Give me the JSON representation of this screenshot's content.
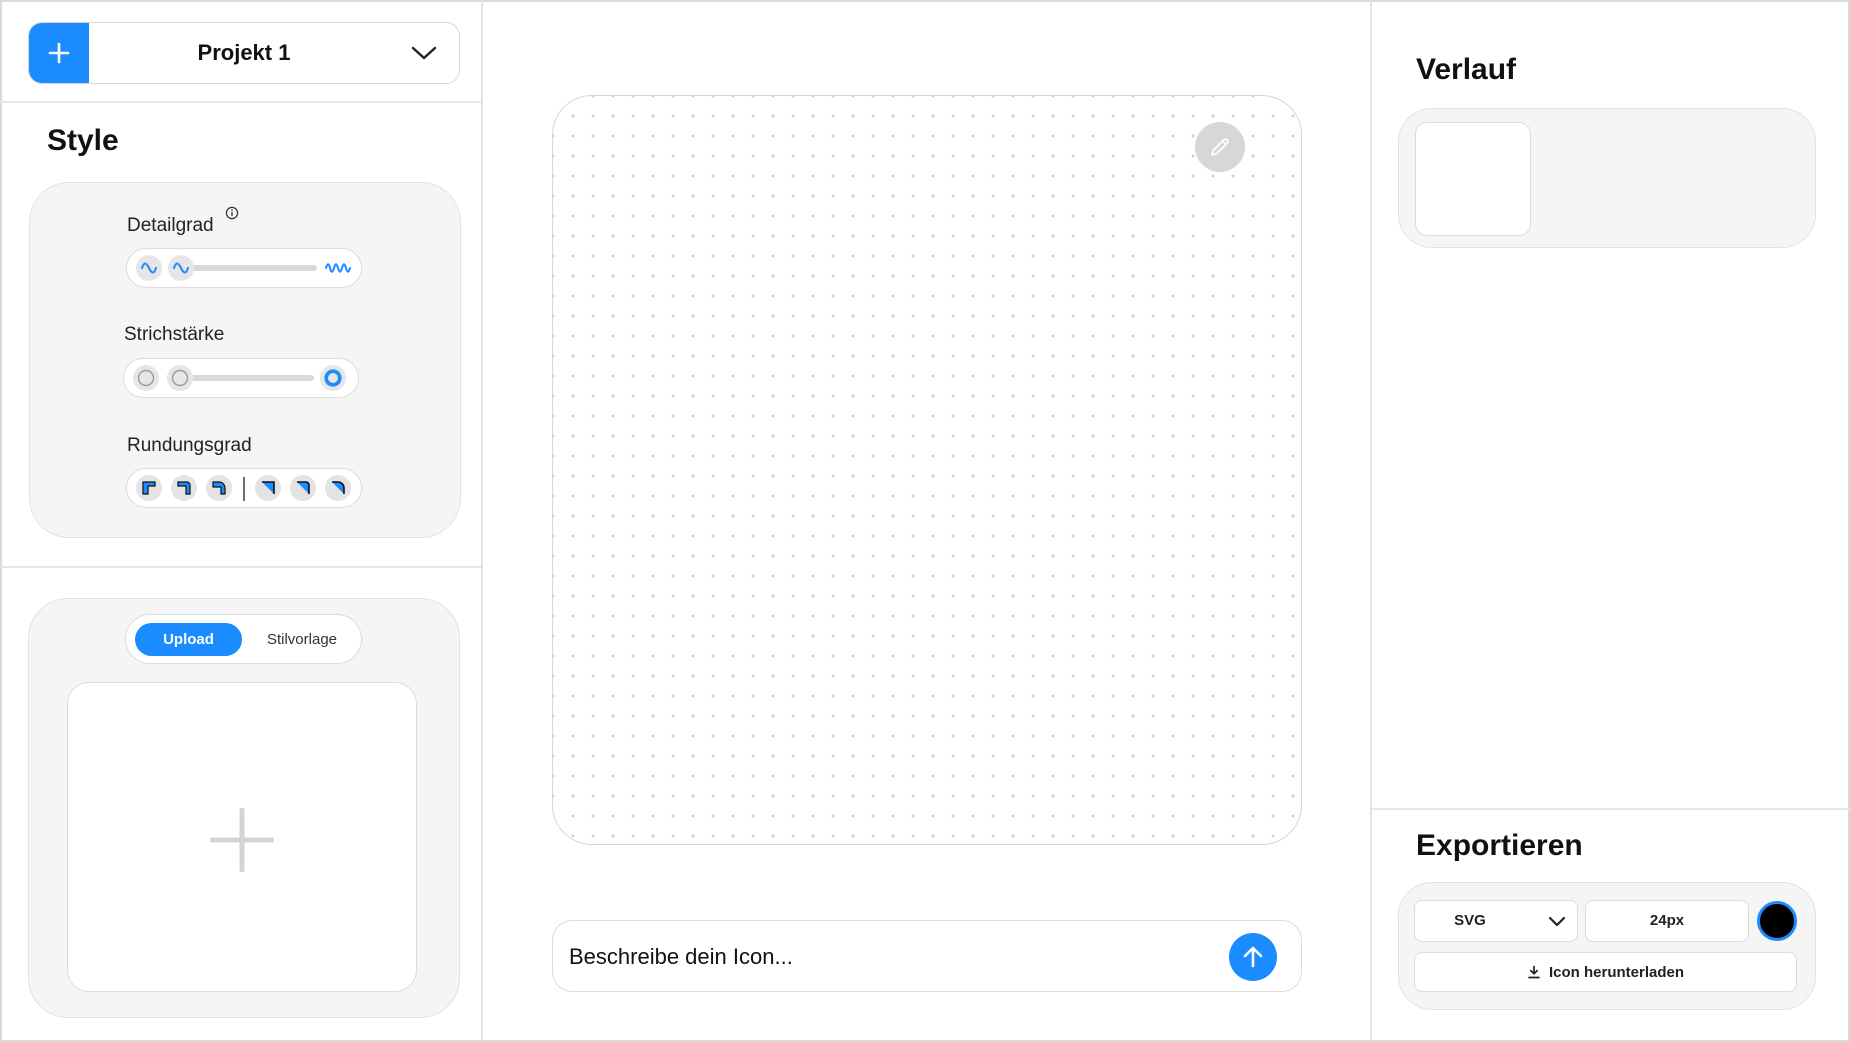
{
  "project": {
    "name": "Projekt 1",
    "add_icon": "plus-icon",
    "chevron_icon": "chevron-down-icon"
  },
  "style": {
    "title": "Style",
    "detail": {
      "label": "Detailgrad",
      "info_icon": "info-icon",
      "level": 0.0
    },
    "stroke": {
      "label": "Strichstärke",
      "level": 0.0
    },
    "rounding": {
      "label": "Rundungsgrad",
      "options_count": 6
    }
  },
  "reference": {
    "tabs": [
      "Upload",
      "Stilvorlage"
    ],
    "active_tab": "Upload",
    "drop_icon": "plus-icon"
  },
  "canvas": {
    "edit_icon": "pencil-icon"
  },
  "prompt": {
    "placeholder": "Beschreibe dein Icon...",
    "send_icon": "arrow-up-icon"
  },
  "history": {
    "title": "Verlauf"
  },
  "export": {
    "title": "Exportieren",
    "format": "SVG",
    "size": "24px",
    "color": "#000000",
    "accent": "#1a8cff",
    "download_label": "Icon herunterladen",
    "download_icon": "download-icon"
  }
}
